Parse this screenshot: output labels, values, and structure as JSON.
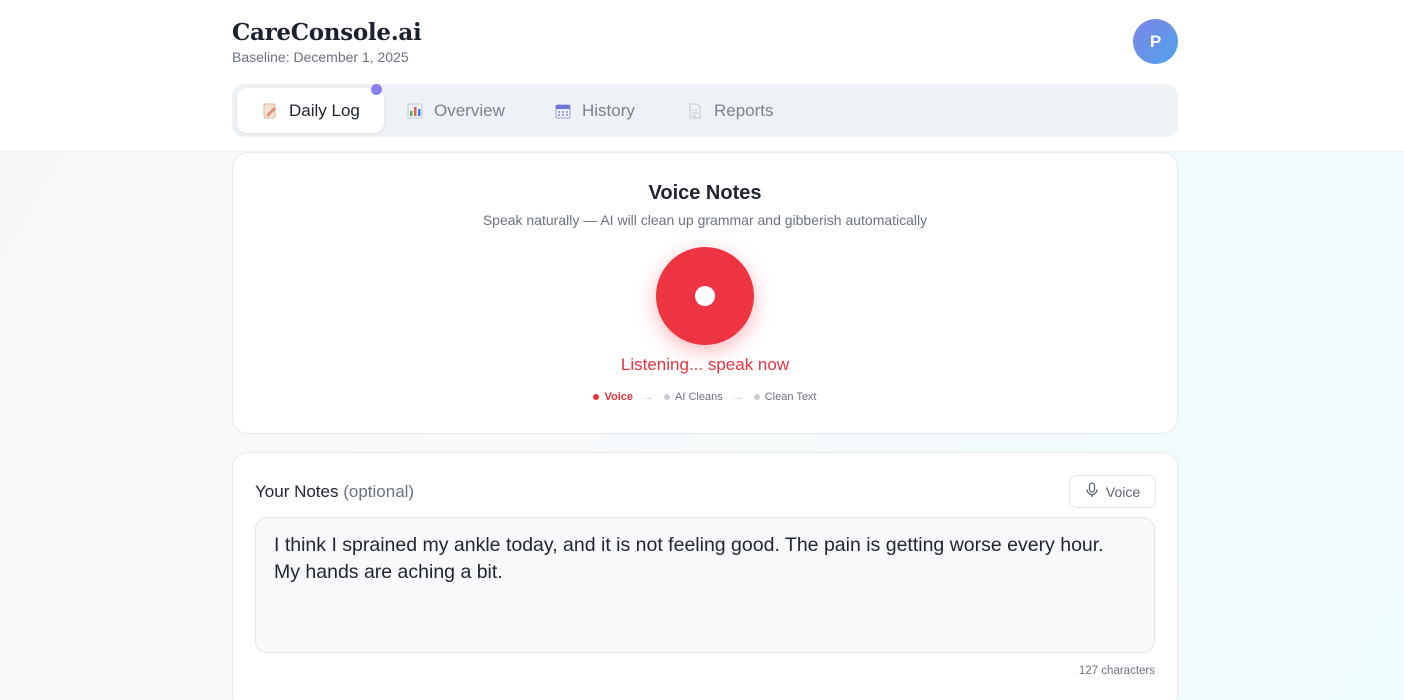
{
  "header": {
    "brand": "CareConsole.ai",
    "baseline": "Baseline: December 1, 2025",
    "avatar_initial": "P"
  },
  "tabs": [
    {
      "label": "Daily Log",
      "icon": "edit-note-icon",
      "active": true
    },
    {
      "label": "Overview",
      "icon": "bar-chart-icon",
      "active": false
    },
    {
      "label": "History",
      "icon": "calendar-icon",
      "active": false
    },
    {
      "label": "Reports",
      "icon": "document-icon",
      "active": false
    }
  ],
  "voice": {
    "title": "Voice Notes",
    "subtitle": "Speak naturally — AI will clean up grammar and gibberish automatically",
    "status": "Listening... speak now",
    "steps": [
      {
        "label": "Voice",
        "active": true
      },
      {
        "label": "AI Cleans",
        "active": false
      },
      {
        "label": "Clean Text",
        "active": false
      }
    ]
  },
  "notes": {
    "label": "Your Notes",
    "optional": "(optional)",
    "voice_button": "Voice",
    "value": "I think I sprained my ankle today, and it is not feeling good. The pain is getting worse every hour.\nMy hands are aching a bit.",
    "char_count": "127 characters"
  },
  "colors": {
    "accent": "#8b7ff0",
    "record": "#ee3442",
    "listening_text": "#e53340"
  }
}
